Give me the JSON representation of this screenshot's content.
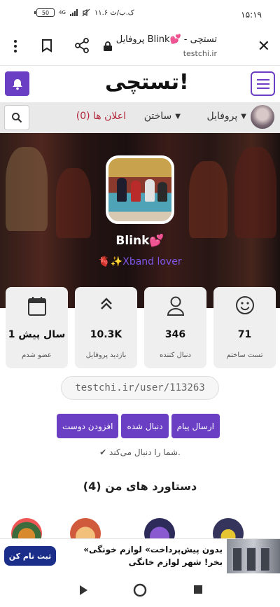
{
  "status_bar": {
    "time": "۱۵:۱۹",
    "battery": "50",
    "network": "4G",
    "speed": "۱۱.۶ ک.ب/ث"
  },
  "browser": {
    "page_title": "پروفایل Blink💕 - تستچی",
    "url": "testchi.ir"
  },
  "site": {
    "logo": "تستچی!"
  },
  "nav": {
    "profile": "پروفایل",
    "build": "ساختن",
    "ads": "اعلان ها (0)"
  },
  "profile": {
    "username": "Blink💕",
    "bio": "🫀✨Xband lover"
  },
  "stats": [
    {
      "value": "71",
      "label": "تست ساختم",
      "icon": "smile-icon"
    },
    {
      "value": "346",
      "label": "دنبال کننده",
      "icon": "user-icon"
    },
    {
      "value": "10.3K",
      "label": "بازدید پروفایل",
      "icon": "chevrons-up-icon"
    },
    {
      "value": "1 سال پیش",
      "label": "عضو شدم",
      "icon": "calendar-icon"
    }
  ],
  "profile_url": "testchi.ir/user/113263",
  "actions": {
    "message": "ارسال پیام",
    "following": "دنبال شده",
    "add_friend": "افزودن دوست"
  },
  "follows_you": "✔ شما را دنبال می‌کند.",
  "achievements_title": "دستاورد های من (4)",
  "ad": {
    "text": "«بدون پیش‌پرداخت» لوازم خونگی بخر! شهر لوازم خانگی",
    "button": "ثبت نام کن"
  },
  "colors": {
    "accent": "#6a3fc3",
    "bio": "#7e57e6",
    "ads_link": "#b3283c",
    "ad_button": "#1a2e8a"
  }
}
